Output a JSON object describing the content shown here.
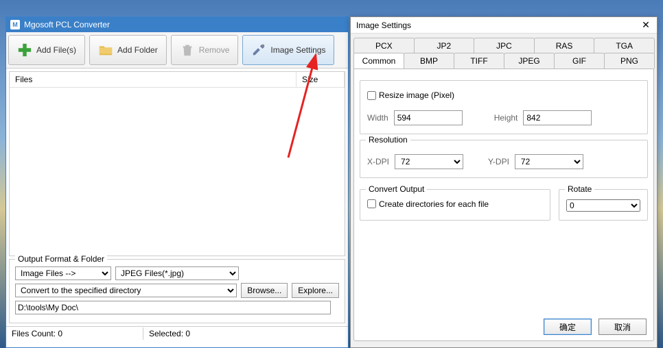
{
  "main": {
    "title": "Mgosoft PCL Converter",
    "toolbar": {
      "add_files": "Add File(s)",
      "add_folder": "Add Folder",
      "remove": "Remove",
      "image_settings": "Image Settings"
    },
    "list": {
      "col_files": "Files",
      "col_size": "Size"
    },
    "output": {
      "legend": "Output Format & Folder",
      "format_sel": "Image Files -->",
      "type_sel": "JPEG Files(*.jpg)",
      "dir_mode": "Convert to the specified directory",
      "browse": "Browse...",
      "explore": "Explore...",
      "path": "D:\\tools\\My Doc\\"
    },
    "status": {
      "files_count": "Files Count: 0",
      "selected": "Selected: 0"
    }
  },
  "dialog": {
    "title": "Image Settings",
    "tabs_top": [
      "PCX",
      "JP2",
      "JPC",
      "RAS",
      "TGA"
    ],
    "tabs_bot": [
      "Common",
      "BMP",
      "TIFF",
      "JPEG",
      "GIF",
      "PNG"
    ],
    "active_tab": "Common",
    "resize": {
      "chk_label": "Resize image (Pixel)",
      "width_label": "Width",
      "width": "594",
      "height_label": "Height",
      "height": "842"
    },
    "resolution": {
      "legend": "Resolution",
      "xdpi_label": "X-DPI",
      "xdpi": "72",
      "ydpi_label": "Y-DPI",
      "ydpi": "72"
    },
    "convert": {
      "legend": "Convert Output",
      "chk_label": "Create directories for each file"
    },
    "rotate": {
      "legend": "Rotate",
      "value": "0"
    },
    "ok": "确定",
    "cancel": "取消"
  }
}
